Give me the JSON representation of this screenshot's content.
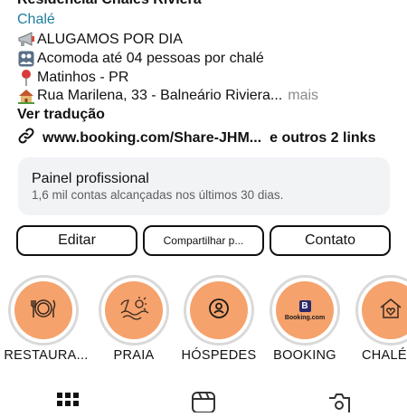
{
  "profile": {
    "name": "Residencial Chalés Riviera",
    "category": "Chalé"
  },
  "bio": {
    "lines": [
      {
        "icon": "megaphone-icon",
        "text": "ALUGAMOS POR DIA"
      },
      {
        "icon": "people-box-icon",
        "text": "Acomoda até 04 pessoas por chalé"
      },
      {
        "icon": "pin-icon",
        "text": "Matinhos - PR"
      },
      {
        "icon": "house-icon",
        "text": "Rua Marilena, 33 - Balneário Riviera..."
      }
    ],
    "more_label": "mais",
    "translate_label": "Ver tradução"
  },
  "links": {
    "url": "www.booking.com/Share-JHM...",
    "others": "e outros 2 links",
    "icon": "link-icon"
  },
  "panel": {
    "title": "Painel profissional",
    "subtitle": "1,6 mil contas alcançadas nos últimos 30 dias."
  },
  "buttons": {
    "edit": "Editar",
    "share": "Compartilhar p...",
    "contact": "Contato"
  },
  "highlights": [
    {
      "label": "RESTAURA...",
      "icon": "plate-icon"
    },
    {
      "label": "PRAIA",
      "icon": "beach-icon"
    },
    {
      "label": "HÓSPEDES",
      "icon": "person-circle-icon"
    },
    {
      "label": "BOOKING",
      "icon": "booking-logo-icon",
      "logo_text": "Booking.com",
      "logo_letter": "B"
    },
    {
      "label": "CHALÉ",
      "icon": "house-heart-icon"
    }
  ],
  "tabs": [
    {
      "icon": "grid-icon"
    },
    {
      "icon": "reels-icon"
    },
    {
      "icon": "tagged-icon"
    }
  ],
  "colors": {
    "accent_link": "#1e7f9e",
    "highlight_fill": "#f5a26c",
    "panel_bg": "#f2f3f5",
    "muted_text": "#8a8a8a"
  }
}
